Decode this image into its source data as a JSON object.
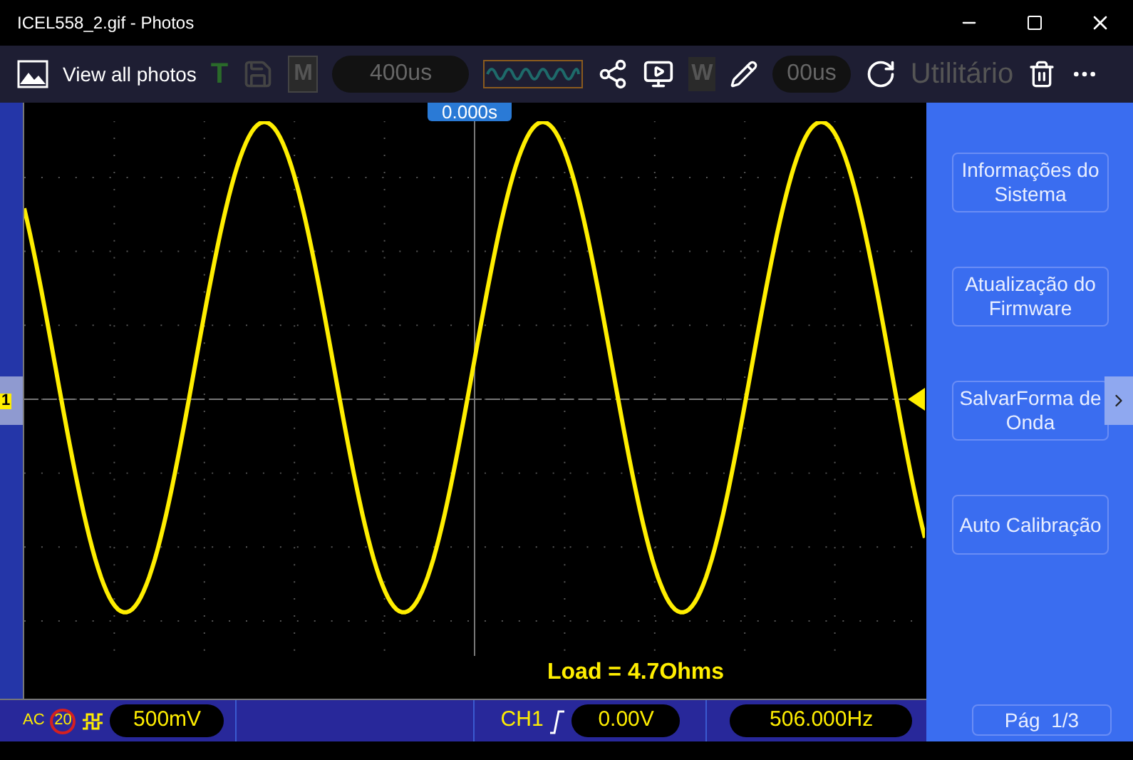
{
  "window": {
    "title": "ICEL558_2.gif - Photos"
  },
  "photos_toolbar": {
    "view_all": "View all photos"
  },
  "scope_toolbar": {
    "trigger_label": "T",
    "mode": "M",
    "timebase": "400us",
    "wave_label": "W",
    "delay": "00us",
    "menu_title": "Utilitário"
  },
  "screen": {
    "time_marker": "0.000s",
    "channel_marker": "1",
    "annotation": "Load = 4.7Ohms"
  },
  "menu": {
    "buttons": [
      "Informações do Sistema",
      "Atualização do Firmware",
      "SalvarForma de Onda",
      "Auto Calibração"
    ],
    "page": "Pág  1/3"
  },
  "status": {
    "coupling": "AC",
    "bandwidth": "20",
    "volts": "500mV",
    "channel": "CH1",
    "trigger_level": "0.00V",
    "frequency": "506.000Hz"
  }
}
